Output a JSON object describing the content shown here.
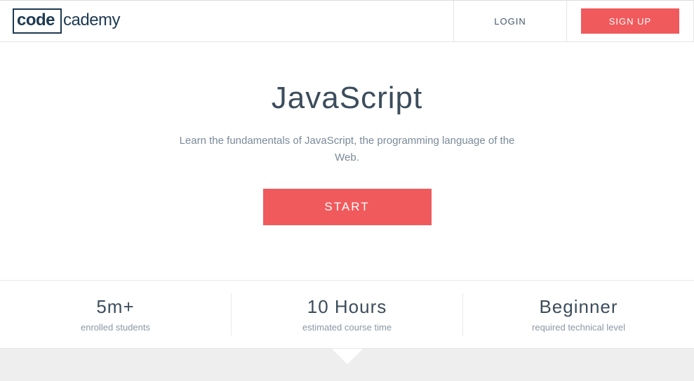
{
  "header": {
    "logo_code": "code",
    "logo_cademy": "cademy",
    "login_label": "LOGIN",
    "signup_label": "SIGN UP"
  },
  "hero": {
    "title": "JavaScript",
    "description": "Learn the fundamentals of JavaScript, the programming language of the Web.",
    "start_label": "START"
  },
  "stats": [
    {
      "value": "5m+",
      "label": "enrolled students"
    },
    {
      "value": "10 Hours",
      "label": "estimated course time"
    },
    {
      "value": "Beginner",
      "label": "required technical level"
    }
  ]
}
